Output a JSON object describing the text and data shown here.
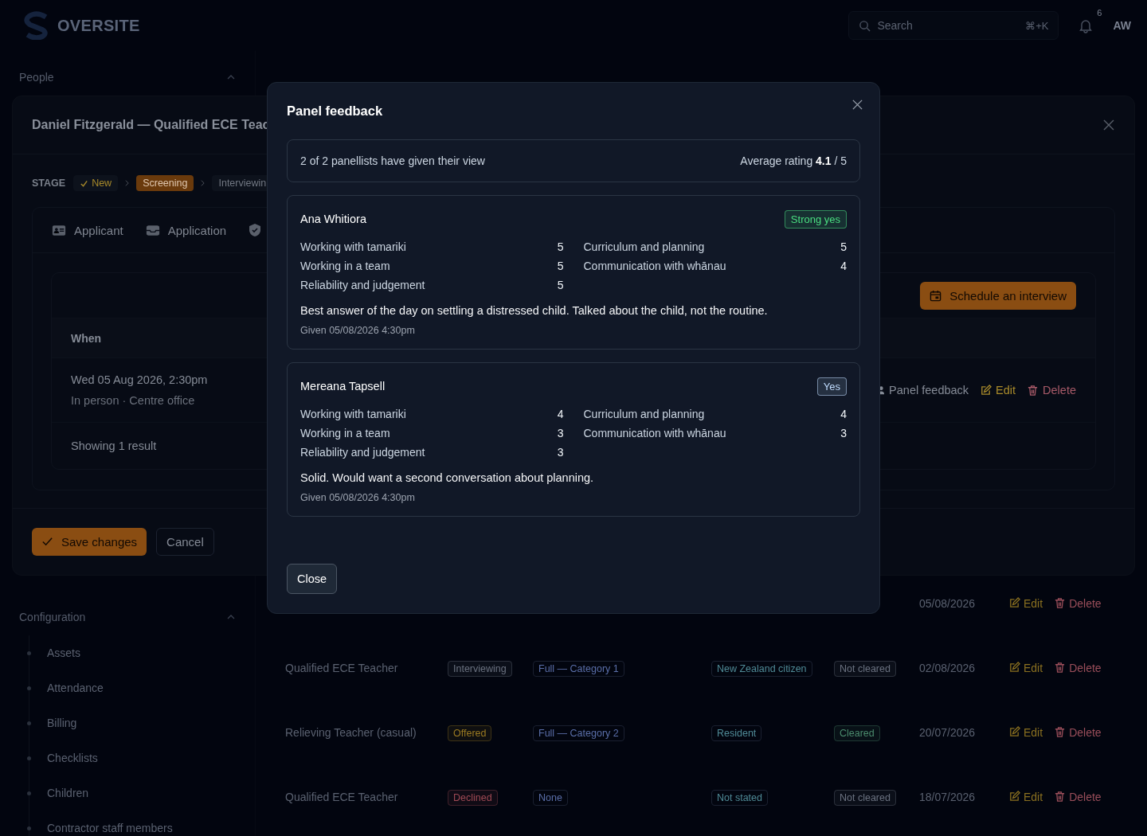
{
  "app": {
    "brand": "OVERSITE",
    "search": {
      "placeholder": "Search",
      "shortcut": "⌘+K"
    },
    "notification_count": "6",
    "user_initials": "AW"
  },
  "sidebar": {
    "sections": [
      {
        "title": "People",
        "expanded": true
      },
      {
        "title": "Configuration",
        "expanded": true,
        "items": [
          "Assets",
          "Attendance",
          "Billing",
          "Checklists",
          "Children",
          "Contractor staff members"
        ]
      }
    ]
  },
  "applications_table": {
    "rows": [
      {
        "date": "05/08/2026",
        "actions": [
          "Edit",
          "Delete"
        ]
      },
      {
        "role": "Qualified ECE Teacher",
        "stage": {
          "label": "Interviewing",
          "color": "#6b7280"
        },
        "category": "Full — Category 1",
        "residency": "New Zealand citizen",
        "police_check": {
          "label": "Not cleared",
          "color": "#6b7280"
        },
        "date": "02/08/2026",
        "actions": [
          "Edit",
          "Delete"
        ]
      },
      {
        "role": "Relieving Teacher (casual)",
        "stage": {
          "label": "Offered",
          "color": "#9a7a22"
        },
        "category": "Full — Category 2",
        "residency": "Resident",
        "police_check": {
          "label": "Cleared",
          "color": "#4a8a6c"
        },
        "date": "20/07/2026",
        "actions": [
          "Edit",
          "Delete"
        ]
      },
      {
        "role": "Qualified ECE Teacher",
        "stage": {
          "label": "Declined",
          "color": "#a04a55"
        },
        "category": "None",
        "residency": "Not stated",
        "police_check": {
          "label": "Not cleared",
          "color": "#6b7280"
        },
        "date": "18/07/2026",
        "actions": [
          "Edit",
          "Delete"
        ]
      }
    ]
  },
  "dialog": {
    "title": "Daniel Fitzgerald — Qualified ECE Teac",
    "stage_label": "STAGE",
    "stages": [
      {
        "label": "New",
        "kind": "done"
      },
      {
        "label": "Screening",
        "kind": "current"
      },
      {
        "label": "Interviewin",
        "kind": "upcoming"
      }
    ],
    "tabs": [
      "Applicant",
      "Application"
    ],
    "interviews": {
      "action": "Schedule an interview",
      "columns": [
        "When"
      ],
      "rows": [
        {
          "when": "Wed 05 Aug 2026, 2:30pm",
          "where": "In person · Centre office",
          "actions": [
            "Panel feedback",
            "Edit",
            "Delete"
          ]
        }
      ],
      "footer": "Showing 1 result"
    },
    "buttons": [
      "Save changes",
      "Cancel"
    ]
  },
  "modal": {
    "title": "Panel feedback",
    "summary": {
      "text": "2 of 2 panellists have given their view",
      "average": "Average rating **4.1** / 5"
    },
    "feedback": [
      {
        "panellist": "Ana Whitiora",
        "verdict": {
          "label": "Strong yes",
          "color": "#4ade80"
        },
        "scores": [
          {
            "criterion": "Working with tamariki",
            "score": "5"
          },
          {
            "criterion": "Curriculum and planning",
            "score": "5"
          },
          {
            "criterion": "Working in a team",
            "score": "5"
          },
          {
            "criterion": "Communication with whānau",
            "score": "4"
          },
          {
            "criterion": "Reliability and judgement",
            "score": "5"
          }
        ],
        "comment": "Best answer of the day on settling a distressed child. Talked about the child, not the routine.",
        "given": "Given 05/08/2026 4:30pm"
      },
      {
        "panellist": "Mereana Tapsell",
        "verdict": {
          "label": "Yes",
          "color": "#bfdbfe"
        },
        "scores": [
          {
            "criterion": "Working with tamariki",
            "score": "4"
          },
          {
            "criterion": "Curriculum and planning",
            "score": "4"
          },
          {
            "criterion": "Working in a team",
            "score": "3"
          },
          {
            "criterion": "Communication with whānau",
            "score": "3"
          },
          {
            "criterion": "Reliability and judgement",
            "score": "3"
          }
        ],
        "comment": "Solid. Would want a second conversation about planning.",
        "given": "Given 05/08/2026 4:30pm"
      }
    ],
    "close": "Close"
  }
}
